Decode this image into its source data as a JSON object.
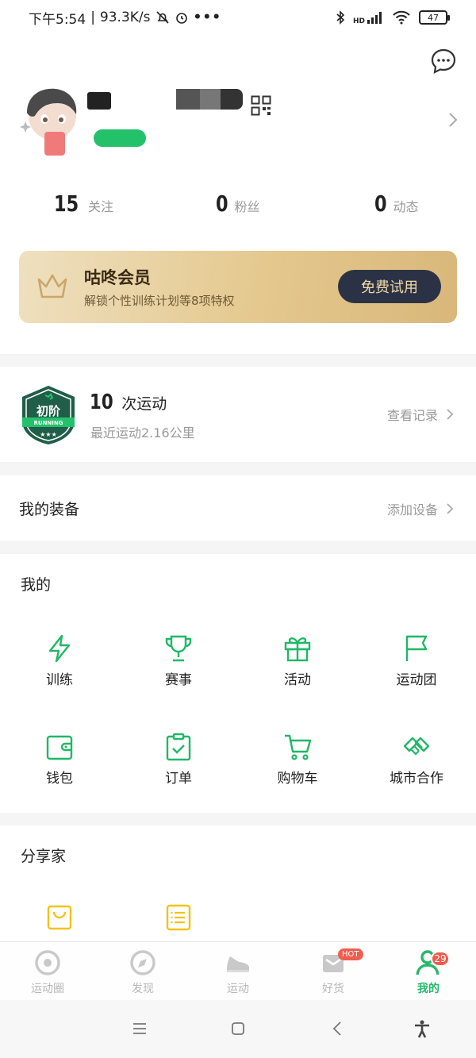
{
  "status_bar": {
    "time": "下午5:54",
    "speed": "93.3K/s",
    "battery": "47",
    "network_label": "HD"
  },
  "profile": {
    "stats": [
      {
        "value": "15",
        "label": "关注"
      },
      {
        "value": "0",
        "label": "粉丝"
      },
      {
        "value": "0",
        "label": "动态"
      }
    ]
  },
  "vip": {
    "title": "咕咚会员",
    "subtitle": "解锁个性训练计划等8项特权",
    "button": "免费试用"
  },
  "run": {
    "badge_text": "初阶",
    "badge_sub": "RUNNING",
    "count": "10",
    "count_unit": "次运动",
    "recent": "最近运动2.16公里",
    "link": "查看记录"
  },
  "equipment": {
    "title": "我的装备",
    "link": "添加设备"
  },
  "mine": {
    "title": "我的",
    "items": [
      {
        "label": "训练",
        "icon": "lightning-icon"
      },
      {
        "label": "赛事",
        "icon": "trophy-icon"
      },
      {
        "label": "活动",
        "icon": "gift-icon"
      },
      {
        "label": "运动团",
        "icon": "flag-icon"
      },
      {
        "label": "钱包",
        "icon": "wallet-icon"
      },
      {
        "label": "订单",
        "icon": "clipboard-icon"
      },
      {
        "label": "购物车",
        "icon": "cart-icon"
      },
      {
        "label": "城市合作",
        "icon": "handshake-icon"
      }
    ]
  },
  "share": {
    "title": "分享家"
  },
  "tabs": [
    {
      "label": "运动圈",
      "icon": "circle-target-icon"
    },
    {
      "label": "发现",
      "icon": "compass-icon"
    },
    {
      "label": "运动",
      "icon": "shoe-icon"
    },
    {
      "label": "好货",
      "icon": "mail-box-icon"
    },
    {
      "label": "我的",
      "icon": "user-icon"
    }
  ],
  "tab_badges": {
    "hot": "HOT",
    "mine_count": "29"
  },
  "colors": {
    "accent": "#1fb866",
    "gold": "#e4c88e",
    "vip_button": "#2c3246",
    "share_icon": "#f2c318"
  }
}
